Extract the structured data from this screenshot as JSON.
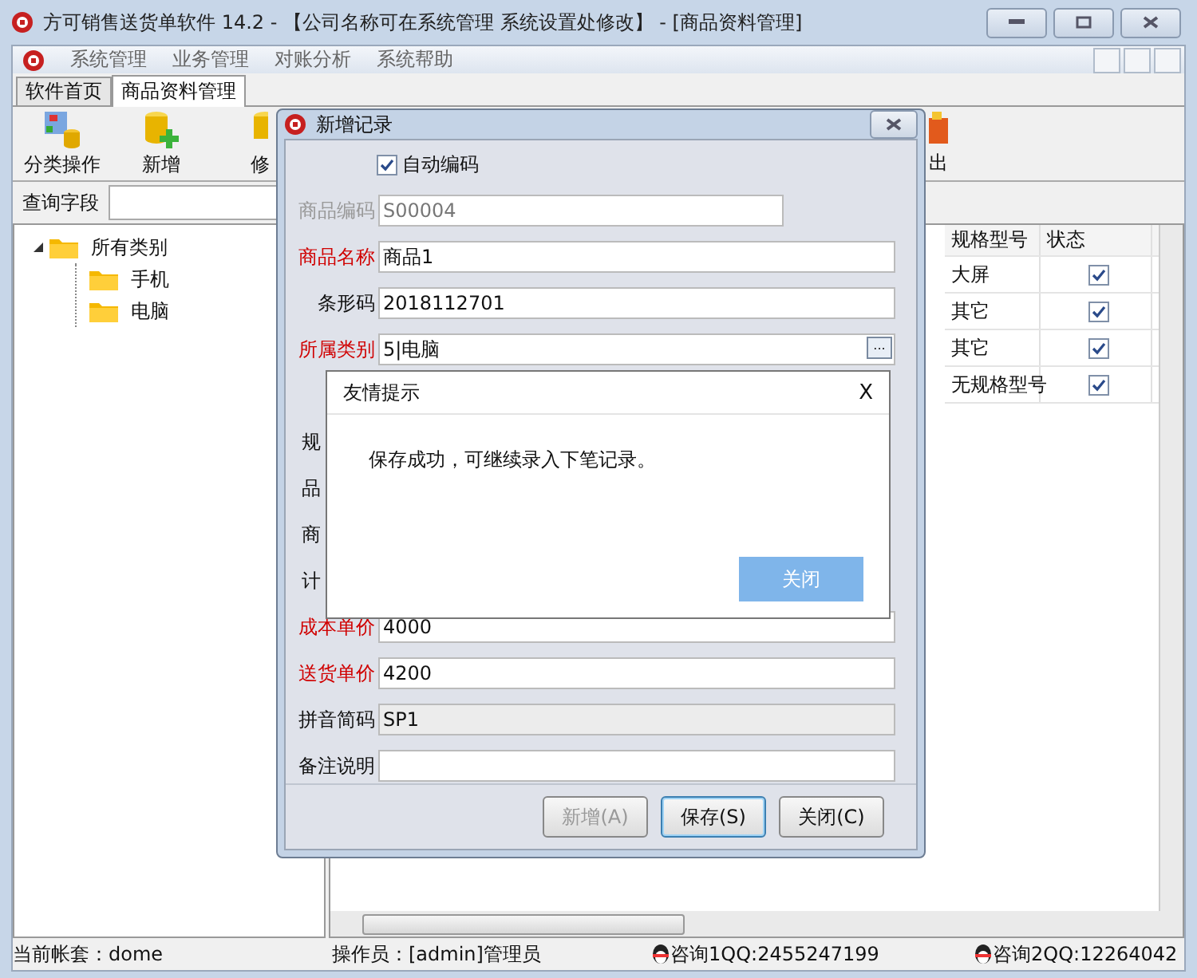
{
  "window": {
    "title": "方可销售送货单软件 14.2 - 【公司名称可在系统管理 系统设置处修改】 - [商品资料管理]"
  },
  "menu": [
    "系统管理",
    "业务管理",
    "对账分析",
    "系统帮助"
  ],
  "tabs": [
    {
      "label": "软件首页",
      "selected": false
    },
    {
      "label": "商品资料管理",
      "selected": true
    }
  ],
  "toolbar": [
    {
      "label": "分类操作",
      "kind": "category"
    },
    {
      "label": "新增",
      "kind": "add"
    },
    {
      "label": "修",
      "kind": "edit"
    }
  ],
  "toolbar_right": {
    "label": "出",
    "kind": "exit"
  },
  "query": {
    "label": "查询字段"
  },
  "tree": [
    {
      "label": "所有类别",
      "expanded": true,
      "children": [
        {
          "label": "手机"
        },
        {
          "label": "电脑"
        }
      ]
    }
  ],
  "grid": {
    "columns": [
      "规格型号",
      "状态"
    ],
    "rows": [
      {
        "spec": "大屏",
        "active": true
      },
      {
        "spec": "其它",
        "active": true
      },
      {
        "spec": "其它",
        "active": true
      },
      {
        "spec": "无规格型号",
        "active": true
      }
    ]
  },
  "status_bar": {
    "account": "当前帐套：dome",
    "operator": "操作员：[admin]管理员",
    "qq1": "咨询1QQ:2455247199",
    "qq2": "咨询2QQ:12264042"
  },
  "dialog": {
    "title": "新增记录",
    "auto_code": {
      "label": "自动编码",
      "checked": true
    },
    "fields_top": [
      {
        "label": "商品编码",
        "value": "S00004",
        "kind": "readonly",
        "required": false
      },
      {
        "label": "商品名称",
        "value": "商品1",
        "kind": "text",
        "required": true
      },
      {
        "label": "条形码",
        "value": "2018112701",
        "kind": "text",
        "required": false
      },
      {
        "label": "所属类别",
        "value": "5|电脑",
        "kind": "picker",
        "required": true,
        "picker_glyph": "..."
      }
    ],
    "fields_bottom": [
      {
        "label": "规",
        "kind": "label_only",
        "required": false
      },
      {
        "label": "品",
        "kind": "label_only",
        "required": false
      },
      {
        "label": "商",
        "kind": "label_only",
        "required": false
      },
      {
        "label": "计",
        "kind": "label_only",
        "required": false
      },
      {
        "label": "成本单价",
        "value": "4000",
        "kind": "text",
        "required": true
      },
      {
        "label": "送货单价",
        "value": "4200",
        "kind": "text",
        "required": true
      },
      {
        "label": "拼音简码",
        "value": "SP1",
        "kind": "grey",
        "required": false
      },
      {
        "label": "备注说明",
        "kind": "text",
        "required": false
      }
    ],
    "buttons": [
      {
        "label": "新增(A)",
        "disabled": true,
        "selected": false
      },
      {
        "label": "保存(S)",
        "disabled": false,
        "selected": true
      },
      {
        "label": "关闭(C)",
        "disabled": false,
        "selected": false
      }
    ]
  },
  "message_box": {
    "title": "友情提示",
    "close": "X",
    "text": "保存成功，可继续录入下笔记录。",
    "button": "关闭"
  }
}
